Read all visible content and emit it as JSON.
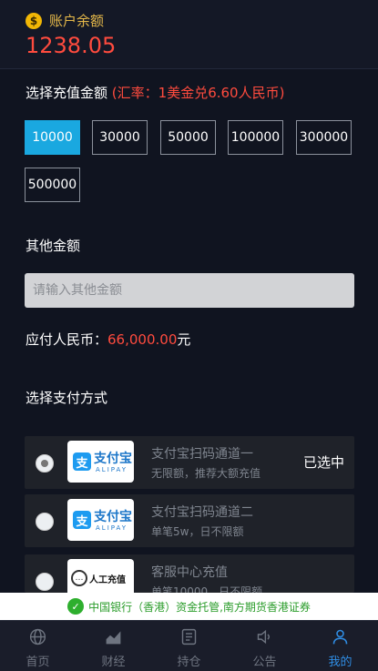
{
  "header": {
    "coin_symbol": "$",
    "balance_label": "账户余额",
    "balance_value": "1238.05"
  },
  "recharge": {
    "title": "选择充值金额",
    "rate": "(汇率：1美金兑6.60人民币)",
    "amounts": [
      "10000",
      "30000",
      "50000",
      "100000",
      "300000",
      "500000"
    ],
    "selected_amount": "10000"
  },
  "other": {
    "title": "其他金额",
    "placeholder": "请输入其他金额"
  },
  "payable": {
    "label": "应付人民币：",
    "amount": "66,000.00",
    "unit": "元"
  },
  "methods": {
    "title": "选择支付方式",
    "items": [
      {
        "logo_cn": "支付宝",
        "logo_en": "ALIPAY",
        "logo_mark": "支",
        "title": "支付宝扫码通道一",
        "subtitle": "无限额，推荐大额充值",
        "selected_text": "已选中"
      },
      {
        "logo_cn": "支付宝",
        "logo_en": "ALIPAY",
        "logo_mark": "支",
        "title": "支付宝扫码通道二",
        "subtitle": "单笔5w，日不限额"
      },
      {
        "logo_cn": "人工充值",
        "logo_mark": "…",
        "title": "客服中心充值",
        "subtitle": "单笔10000，日不限额"
      }
    ]
  },
  "banner": {
    "icon": "✓",
    "text": "中国银行（香港）资金托管,南方期货香港证券"
  },
  "nav": [
    {
      "label": "首页",
      "icon": "globe-icon"
    },
    {
      "label": "财经",
      "icon": "chart-icon"
    },
    {
      "label": "持仓",
      "icon": "document-icon"
    },
    {
      "label": "公告",
      "icon": "speaker-icon"
    },
    {
      "label": "我的",
      "icon": "user-icon",
      "active": true
    }
  ],
  "colors": {
    "accent": "#1aa8e0",
    "warn": "#ff4b3e",
    "gold": "#e6b94a",
    "active_nav": "#2f8de4"
  }
}
